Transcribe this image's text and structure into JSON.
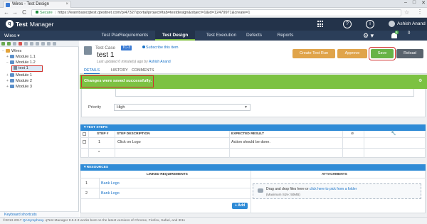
{
  "browser": {
    "tab_title": "Wires - Test Design",
    "tab_close": "×",
    "window_controls": [
      "–",
      "□",
      "✕"
    ],
    "secure_label": "Secure",
    "url": "https://learnbasicqtest.qtestnet.com/p/47327/portal/project#tab=testdesign&object=1&id=12479971&create=1",
    "nav": [
      "←",
      "→",
      "C"
    ]
  },
  "app": {
    "logo_q": "q",
    "logo_name": "Test",
    "logo_suffix": "Manager",
    "user_name": "Ashish Anand",
    "help_glyph": "?",
    "info_glyph": "i",
    "notification_count": "6",
    "notification_label": "0"
  },
  "modnav": {
    "project": "Wires ▾",
    "tabs": [
      "Test Plan",
      "Requirements",
      "Test Design",
      "Test Execution",
      "Defects",
      "Reports"
    ],
    "active_tab": "Test Design",
    "gear_glyph": "⚙ ▾"
  },
  "tree": {
    "root": "Wires",
    "items": [
      {
        "label": "Module 1.1",
        "toggle": "+"
      },
      {
        "label": "Module 1.2",
        "toggle": "−"
      },
      {
        "label": "Module 1",
        "toggle": "+"
      },
      {
        "label": "Module 2",
        "toggle": "+"
      },
      {
        "label": "Module 3",
        "toggle": "+"
      }
    ],
    "selected_item": "test 1",
    "keyboard_shortcuts": "Keyboard shortcuts"
  },
  "testcase": {
    "label": "Test Case",
    "badge": "TC-3",
    "subscribe": "Subscribe this item",
    "title": "test 1",
    "last_saved_prefix": "Last updated 0 minute(s) ago by",
    "last_saved_user": "Ashish Anand",
    "actions": {
      "create": "Create Test Run",
      "approve": "Approve",
      "save": "Save",
      "reload": "Reload"
    },
    "subtabs": [
      "DETAILS",
      "HISTORY",
      "COMMENTS"
    ],
    "active_subtab": "DETAILS"
  },
  "notification": {
    "message": "Changes were saved successfully.",
    "close": "⚙"
  },
  "properties": {
    "priority_label": "Priority",
    "priority_value": "High"
  },
  "test_steps": {
    "header": "▾ TEST STEPS",
    "columns": [
      "STEP #",
      "STEP DESCRIPTION",
      "EXPECTED RESULT"
    ],
    "rows": [
      {
        "num": "1",
        "desc": "Click on Logo",
        "expected": "Action should be done."
      },
      {
        "num": "*",
        "desc": "",
        "expected": ""
      }
    ],
    "attach_glyph": "⊘",
    "tool_glyph": "🔧"
  },
  "resources": {
    "header": "▾ RESOURCES",
    "linked_header": "LINKED REQUIREMENTS",
    "attachments_header": "ATTACHMENTS",
    "rows": [
      {
        "num": "1",
        "name": "Bank Logo"
      },
      {
        "num": "2",
        "name": "Bank Logo"
      }
    ],
    "add_label": "+ Add",
    "drop_text": "Drag and drop files here or",
    "drop_link": "click here to pick from a folder",
    "max_size": "(Maximum Size: 50MB)"
  },
  "statusbar": {
    "copyright": "©2013-2017",
    "company": "QASymphony",
    "text": ". qTest Manager 8.5.3.3 works best on the latest versions of Chrome, Firefox, Safari, and IE11"
  },
  "colors": {
    "header": "#23334a",
    "nav": "#2b3e59",
    "success": "#7cc242",
    "save": "#67b347",
    "approve": "#e0a44a",
    "section": "#2f8bd6",
    "highlight": "#d0312d"
  }
}
